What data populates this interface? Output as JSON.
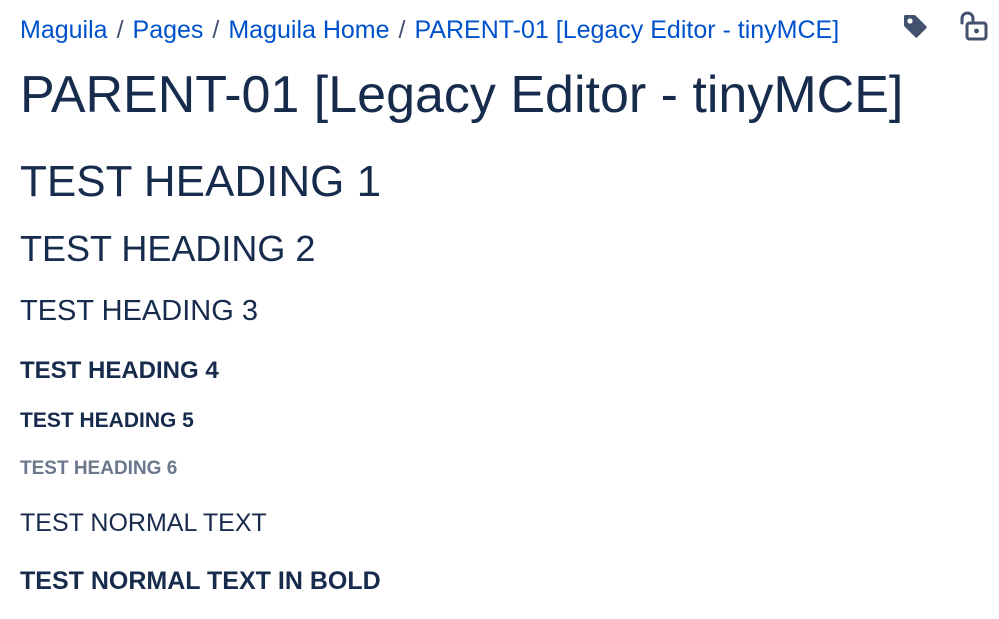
{
  "breadcrumbs": [
    {
      "label": "Maguila"
    },
    {
      "label": "Pages"
    },
    {
      "label": "Maguila Home"
    },
    {
      "label": "PARENT-01 [Legacy Editor - tinyMCE]"
    }
  ],
  "breadcrumb_separator": "/",
  "page_title": "PARENT-01 [Legacy Editor - tinyMCE]",
  "content": {
    "heading1": "TEST HEADING 1",
    "heading2": "TEST HEADING 2",
    "heading3": "TEST HEADING 3",
    "heading4": "TEST HEADING 4",
    "heading5": "TEST HEADING 5",
    "heading6": "TEST HEADING 6",
    "normal_text": "TEST NORMAL TEXT",
    "bold_text": "TEST NORMAL TEXT IN BOLD"
  },
  "icons": {
    "labels": "tag-icon",
    "restrictions": "unlock-icon"
  },
  "colors": {
    "link": "#0052cc",
    "heading": "#172b4d",
    "muted": "#6b778c",
    "icon": "#42526e"
  }
}
